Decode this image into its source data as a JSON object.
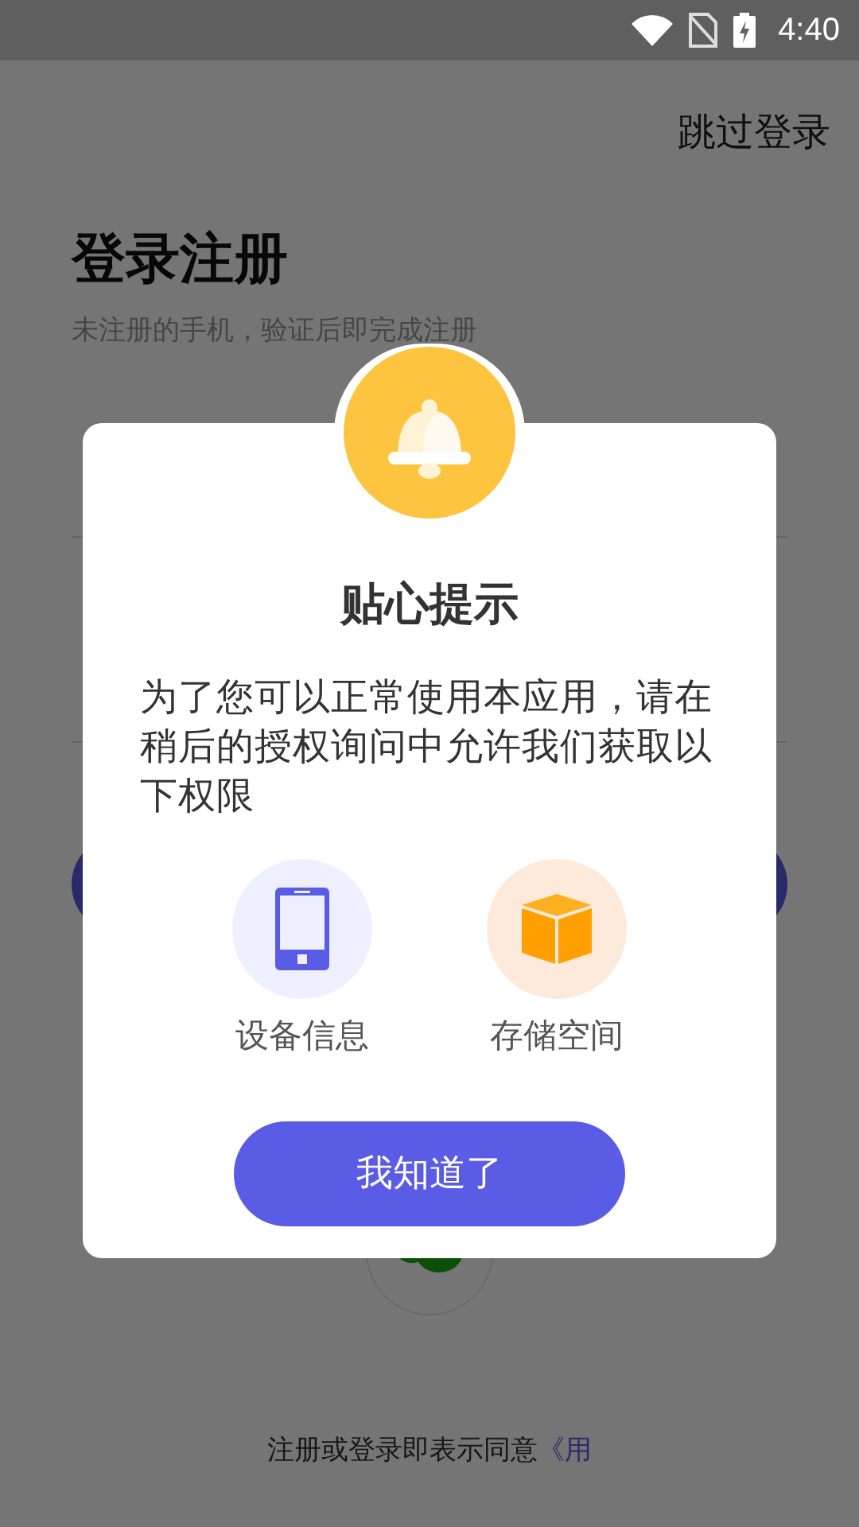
{
  "status_bar": {
    "time": "4:40"
  },
  "page": {
    "skip_link": "跳过登录",
    "title": "登录注册",
    "subtitle": "未注册的手机，验证后即完成注册",
    "agreement": {
      "text": "注册或登录即表示同意",
      "link": "《用"
    }
  },
  "dialog": {
    "title": "贴心提示",
    "message": "为了您可以正常使用本应用，请在稍后的授权询问中允许我们获取以下权限",
    "permissions": [
      {
        "kind": "device",
        "label": "设备信息"
      },
      {
        "kind": "storage",
        "label": "存储空间"
      }
    ],
    "button": "我知道了"
  }
}
